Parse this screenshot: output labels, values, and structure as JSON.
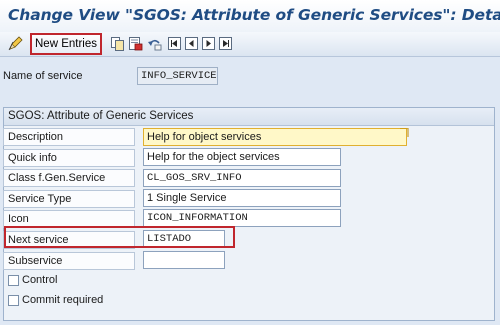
{
  "window": {
    "title": "Change View \"SGOS: Attribute of Generic Services\": Details"
  },
  "toolbar": {
    "new_entries_label": "New Entries",
    "icons": [
      "display-change-icon",
      "copy-icon",
      "delete-icon",
      "undo-icon",
      "first-entry-icon",
      "previous-entry-icon",
      "next-entry-icon",
      "last-entry-icon"
    ]
  },
  "header": {
    "name_label": "Name of service",
    "name_value": "INFO_SERVICE"
  },
  "group": {
    "title": "SGOS: Attribute of Generic Services",
    "description_label": "Description",
    "description_value": "Help for object services",
    "quick_info_label": "Quick info",
    "quick_info_value": "Help for the object services",
    "class_label": "Class f.Gen.Service",
    "class_value": "CL_GOS_SRV_INFO",
    "service_type_label": "Service Type",
    "service_type_value": "1 Single Service",
    "icon_label": "Icon",
    "icon_value": "ICON_INFORMATION",
    "next_service_label": "Next service",
    "next_service_value": "LISTADO",
    "subservice_label": "Subservice",
    "subservice_value": "",
    "control_label": "Control",
    "commit_label": "Commit required"
  },
  "colors": {
    "title": "#1f4c83",
    "highlight": "#c0262d",
    "background": "#dfe8f4",
    "required_field": "#fff8c8"
  }
}
